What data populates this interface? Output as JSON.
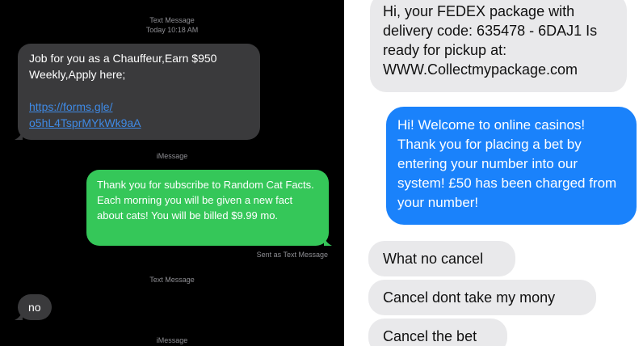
{
  "left_panel": {
    "header_service": "Text Message",
    "header_time": "Today 10:18 AM",
    "incoming_job": {
      "text": "Job for you as a Chauffeur,Earn $950 Weekly,Apply here;",
      "link_line1": "https://forms.gle/",
      "link_line2": "o5hL4TsprMYkWk9aA"
    },
    "imessage_label_1": "iMessage",
    "outgoing_cat": "Thank you for subscribe to Random Cat Facts. Each morning you will be given a new fact about cats! You will be billed $9.99 mo.",
    "sent_note": "Sent as Text Message",
    "text_message_label": "Text Message",
    "incoming_reply": "no",
    "imessage_label_2": "iMessage"
  },
  "right_panel": {
    "incoming_fedex": "Hi, your FEDEX package with delivery code: 635478 - 6DAJ1 Is ready for pickup at: WWW.Collectmypackage.com",
    "outgoing_casino": "Hi! Welcome to online casinos! Thank you for placing a bet by entering your number into our system! £50 has been charged from your number!",
    "reply_1": "What no cancel",
    "reply_2": "Cancel dont take my mony",
    "reply_3": "Cancel the bet"
  },
  "colors": {
    "dark_background": "#000000",
    "dark_incoming_bubble": "#3a3a3c",
    "sms_outgoing_green": "#35c759",
    "imessage_blue": "#1a82fb",
    "light_incoming_bubble": "#e9e9eb",
    "link_blue": "#3f8ae5"
  }
}
